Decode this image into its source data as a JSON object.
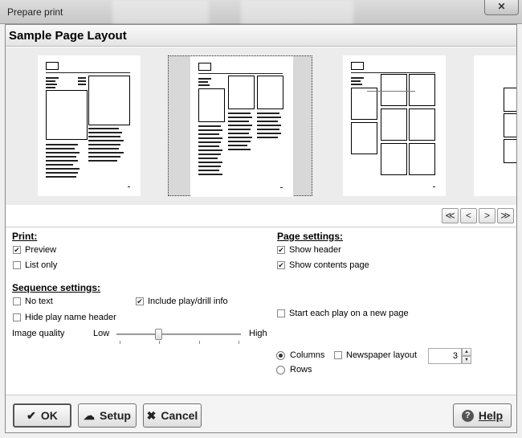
{
  "window": {
    "title": "Prepare print",
    "close_label": "✕"
  },
  "panel": {
    "title": "Sample Page Layout"
  },
  "layouts": [
    "layout-1",
    "layout-2",
    "layout-3",
    "layout-4"
  ],
  "nav": {
    "first": "≪",
    "prev": "<",
    "next": ">",
    "last": "≫"
  },
  "print": {
    "title": "Print:",
    "preview": {
      "label": "Preview",
      "checked": true
    },
    "list_only": {
      "label": "List only",
      "checked": false
    }
  },
  "page_settings": {
    "title": "Page settings:",
    "show_header": {
      "label": "Show header",
      "checked": true
    },
    "show_contents": {
      "label": "Show contents page",
      "checked": true
    }
  },
  "sequence": {
    "title": "Sequence settings:",
    "no_text": {
      "label": "No text",
      "checked": false
    },
    "include_drill": {
      "label": "Include play/drill info",
      "checked": true
    },
    "hide_name": {
      "label": "Hide play name header",
      "checked": false
    },
    "new_page": {
      "label": "Start each play on a new page",
      "checked": false
    }
  },
  "image_quality": {
    "label": "Image quality",
    "low": "Low",
    "high": "High",
    "level": 0.35
  },
  "columns": {
    "columns_label": "Columns",
    "rows_label": "Rows",
    "selected": "Columns",
    "newspaper": {
      "label": "Newspaper layout",
      "checked": false
    },
    "count": "3",
    "up": "▲",
    "down": "▼"
  },
  "buttons": {
    "ok": "OK",
    "setup": "Setup",
    "cancel": "Cancel",
    "help": "Help"
  },
  "icons": {
    "ok": "✔",
    "setup": "☁",
    "cancel": "✖",
    "help": "?"
  }
}
